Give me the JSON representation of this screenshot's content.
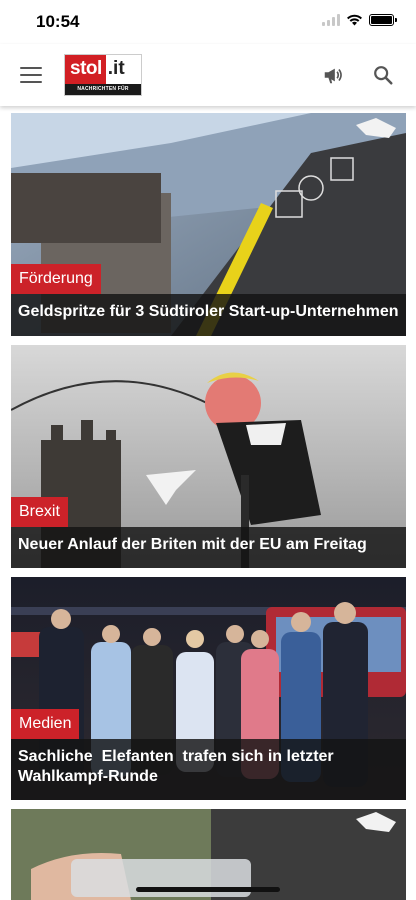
{
  "status_bar": {
    "time": "10:54"
  },
  "header": {
    "logo_main": "stol",
    "logo_suffix": ".it",
    "logo_tagline": "NACHRICHTEN FÜR SÜDTIROL",
    "icons": [
      "menu-icon",
      "megaphone-icon",
      "search-icon"
    ]
  },
  "articles": [
    {
      "category": "Förderung",
      "title": "Geldspritze für 3 Südtiroler Start-up-Unternehmen"
    },
    {
      "category": "Brexit",
      "title": "Neuer Anlauf der Briten mit der EU am Freitag"
    },
    {
      "category": "Medien",
      "title": "Sachliche  Elefanten  trafen sich in letzter Wahlkampf-Runde"
    }
  ],
  "colors": {
    "brand_red": "#cc2229",
    "caption_bg": "#141414",
    "header_icon": "#555555"
  }
}
